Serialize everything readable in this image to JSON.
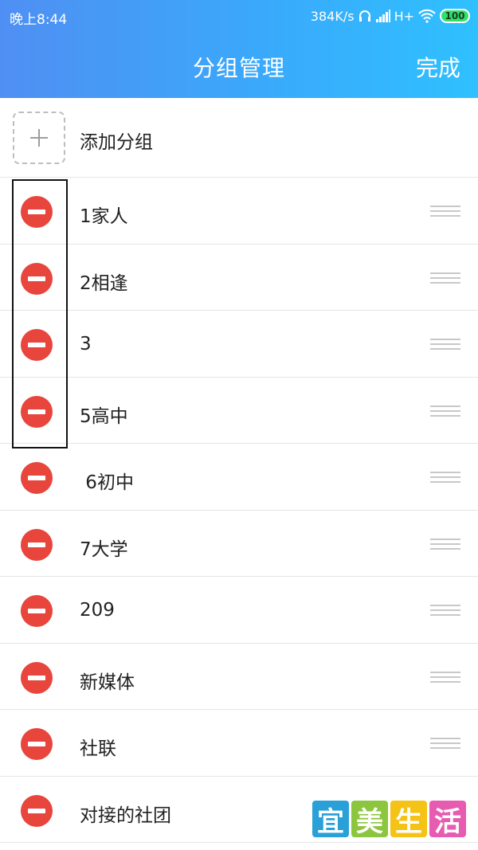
{
  "status_bar": {
    "time": "晚上8:44",
    "speed": "384K/s",
    "network": "H+",
    "battery": "100"
  },
  "header": {
    "title": "分组管理",
    "done_label": "完成"
  },
  "add_group": {
    "label": "添加分组"
  },
  "groups": [
    {
      "label": "1家人"
    },
    {
      "label": "2相逢"
    },
    {
      "label": "3"
    },
    {
      "label": "5高中"
    },
    {
      "label": " 6初中"
    },
    {
      "label": "7大学"
    },
    {
      "label": "209"
    },
    {
      "label": "新媒体"
    },
    {
      "label": "社联"
    },
    {
      "label": "对接的社团"
    }
  ],
  "watermark": {
    "chars": [
      "宜",
      "美",
      "生",
      "活"
    ]
  },
  "colors": {
    "header_start": "#4f8ff3",
    "header_end": "#2fc0ff",
    "delete": "#e8453c"
  }
}
